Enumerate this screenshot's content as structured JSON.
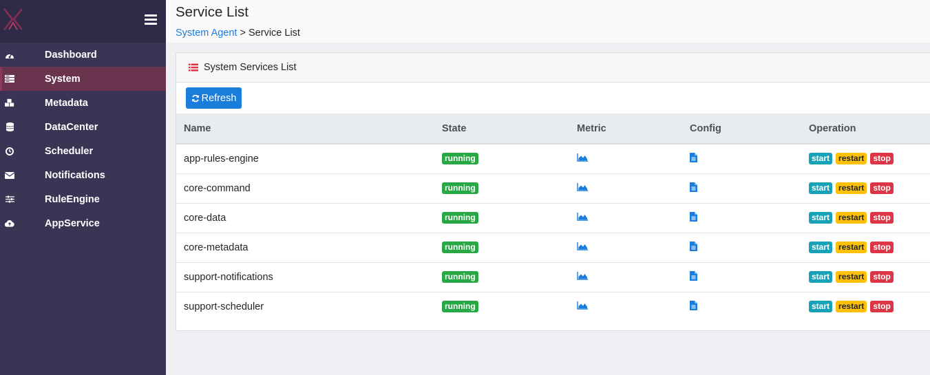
{
  "sidebar": {
    "items": [
      {
        "label": "Dashboard",
        "icon": "dashboard-icon"
      },
      {
        "label": "System",
        "icon": "server-icon",
        "active": true
      },
      {
        "label": "Metadata",
        "icon": "cubes-icon"
      },
      {
        "label": "DataCenter",
        "icon": "database-icon"
      },
      {
        "label": "Scheduler",
        "icon": "clock-icon"
      },
      {
        "label": "Notifications",
        "icon": "envelope-icon"
      },
      {
        "label": "RuleEngine",
        "icon": "sliders-icon"
      },
      {
        "label": "AppService",
        "icon": "cloud-upload-icon"
      }
    ]
  },
  "header": {
    "title": "Service List",
    "breadcrumb_link": "System Agent",
    "breadcrumb_sep": ">",
    "breadcrumb_current": "Service List"
  },
  "card": {
    "title": "System Services List",
    "refresh_label": "Refresh"
  },
  "table": {
    "columns": [
      "Name",
      "State",
      "Metric",
      "Config",
      "Operation"
    ],
    "rows": [
      {
        "name": "app-rules-engine",
        "state": "running"
      },
      {
        "name": "core-command",
        "state": "running"
      },
      {
        "name": "core-data",
        "state": "running"
      },
      {
        "name": "core-metadata",
        "state": "running"
      },
      {
        "name": "support-notifications",
        "state": "running"
      },
      {
        "name": "support-scheduler",
        "state": "running"
      }
    ],
    "ops": {
      "start": "start",
      "restart": "restart",
      "stop": "stop"
    }
  },
  "colors": {
    "sidebar_bg": "#3b3454",
    "sidebar_active": "#6a344f",
    "primary": "#1a7ddb",
    "running": "#28a745",
    "start": "#17a2b8",
    "restart": "#ffc107",
    "stop": "#dc3545"
  }
}
